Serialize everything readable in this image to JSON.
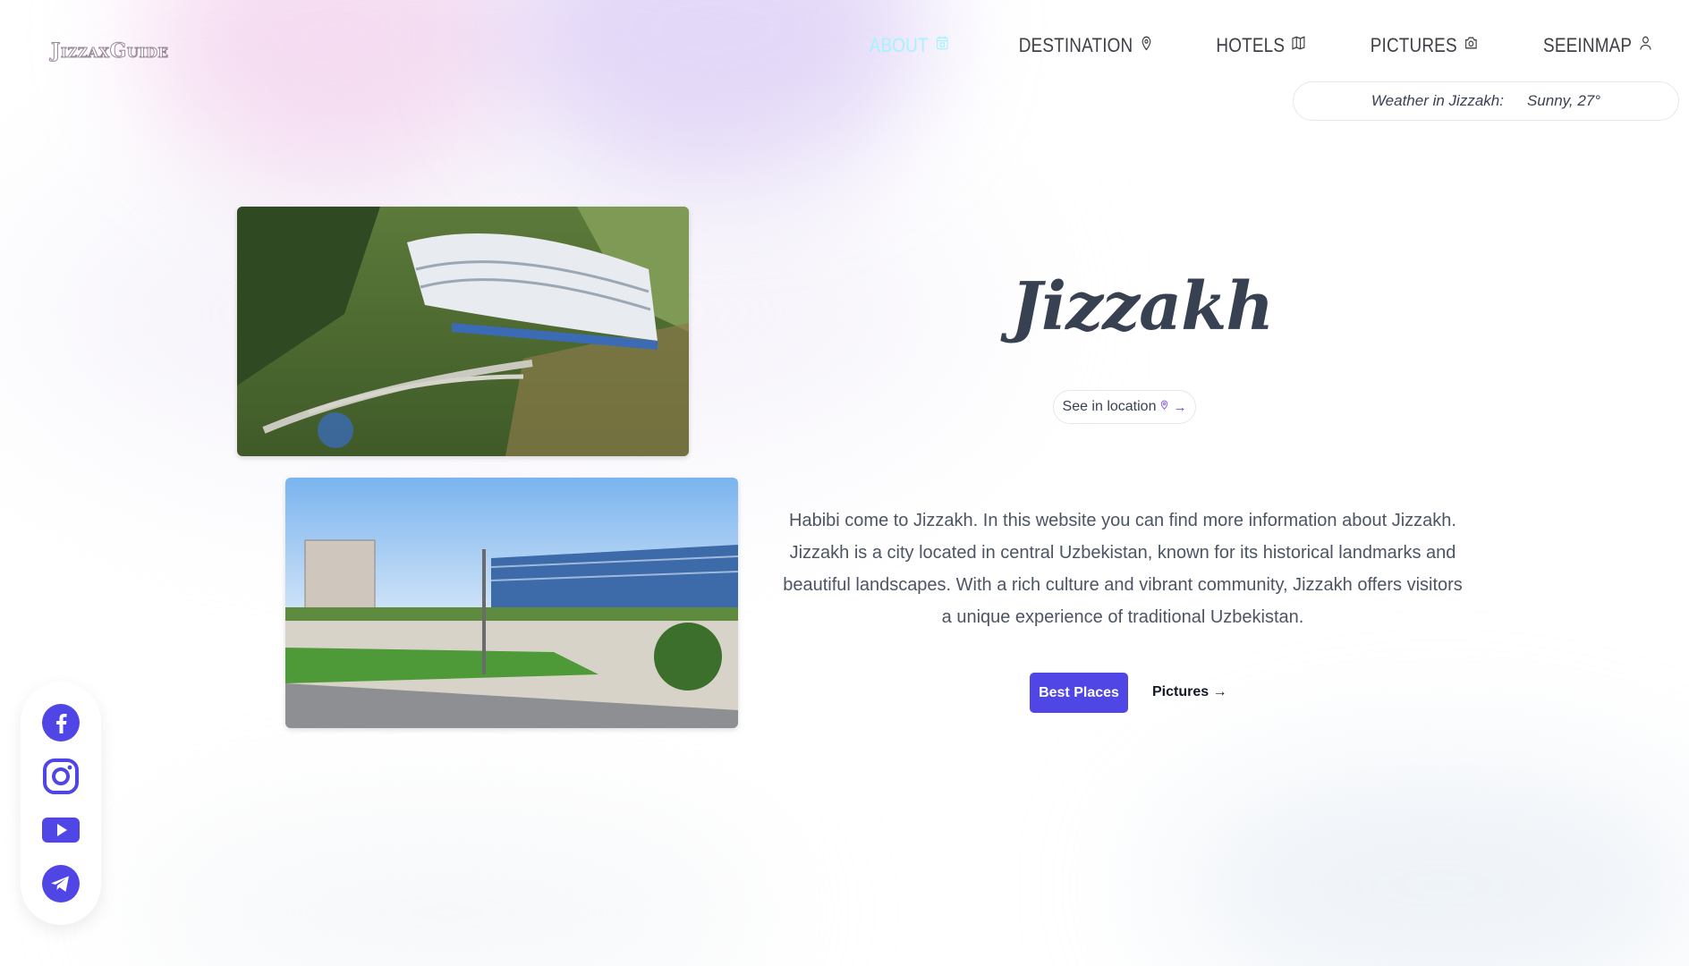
{
  "brand": {
    "logo_text": "JizzaxGuide"
  },
  "nav": {
    "items": [
      {
        "label": "ABOUT",
        "icon": "calendar-icon",
        "active": true
      },
      {
        "label": "DESTINATION",
        "icon": "map-pin-icon",
        "active": false
      },
      {
        "label": "HOTELS",
        "icon": "map-icon",
        "active": false
      },
      {
        "label": "PICTURES",
        "icon": "camera-icon",
        "active": false
      },
      {
        "label": "SEEINMAP",
        "icon": "user-pin-icon",
        "active": false
      }
    ]
  },
  "weather": {
    "label": "Weather in Jizzakh:",
    "value": "Sunny, 27°"
  },
  "hero": {
    "title": "Jizzakh",
    "location_button": "See in location",
    "location_arrow": "→",
    "description": "Habibi come to Jizzakh. In this website you can find more information about Jizzakh. Jizzakh is a city located in central Uzbekistan, known for its historical landmarks and beautiful landscapes. With a rich culture and vibrant community, Jizzakh offers visitors a unique experience of traditional Uzbekistan.",
    "primary_button": "Best Places",
    "secondary_link": "Pictures →"
  },
  "images": [
    {
      "icon": "hotel-on-hillside-photo"
    },
    {
      "icon": "city-square-buildings-photo"
    }
  ],
  "social": [
    {
      "icon": "facebook-icon"
    },
    {
      "icon": "instagram-icon"
    },
    {
      "icon": "youtube-icon"
    },
    {
      "icon": "telegram-icon"
    }
  ],
  "colors": {
    "accent": "#4f46e5",
    "active_nav": "#a5f3fc",
    "text": "#374151"
  }
}
